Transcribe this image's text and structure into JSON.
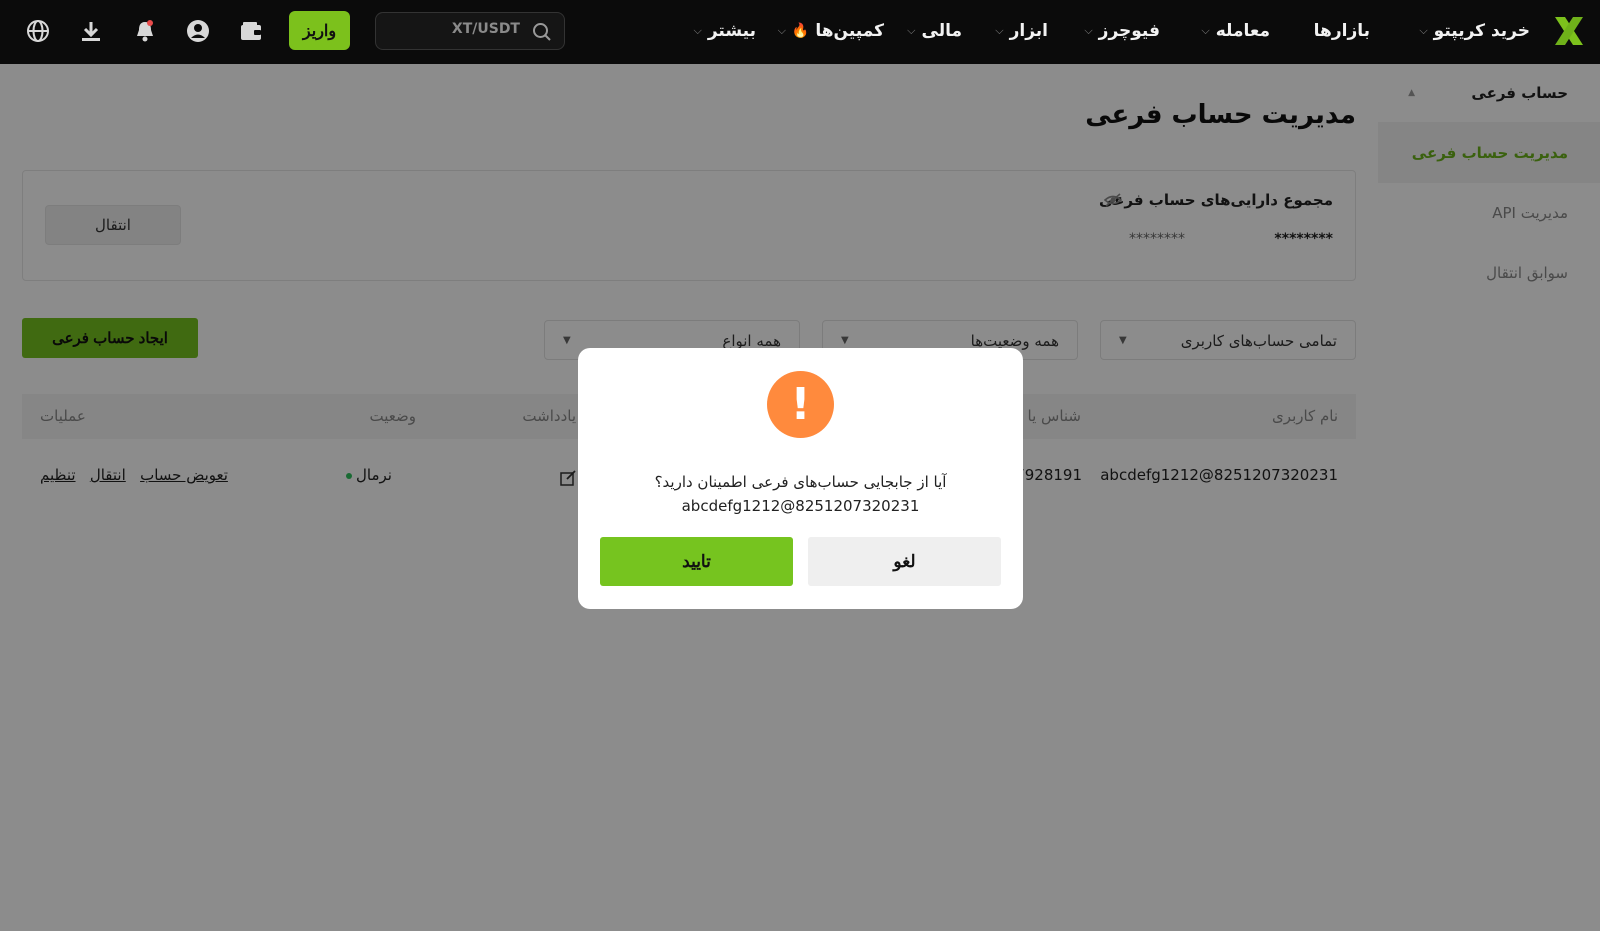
{
  "nav": {
    "items": [
      {
        "label": "خرید کریپتو",
        "has_dropdown": true
      },
      {
        "label": "بازارها",
        "has_dropdown": false
      },
      {
        "label": "معامله",
        "has_dropdown": true
      },
      {
        "label": "فیوچرز",
        "has_dropdown": true
      },
      {
        "label": "ابزار",
        "has_dropdown": true
      },
      {
        "label": "مالی",
        "has_dropdown": true
      },
      {
        "label": "کمپین‌ها",
        "has_dropdown": true,
        "hot": true
      },
      {
        "label": "بیشتر",
        "has_dropdown": true
      }
    ],
    "search_placeholder": "XT/USDT",
    "deposit_label": "واریز",
    "icons": [
      "wallet-icon",
      "user-icon",
      "bell-icon",
      "download-icon",
      "globe-icon"
    ],
    "accent_color": "#7cc11c"
  },
  "sidebar": {
    "group_title": "حساب فرعی",
    "items": [
      {
        "label": "مدیریت حساب فرعی",
        "active": true
      },
      {
        "label": "مدیریت API",
        "active": false
      },
      {
        "label": "سوابق انتقال",
        "active": false
      }
    ]
  },
  "main": {
    "title": "مدیریت حساب فرعی",
    "assets": {
      "label": "مجموع دارایی‌های حساب فرعی",
      "value_1": "********",
      "value_2": "********",
      "transfer_label": "انتقال"
    },
    "filters": [
      {
        "value": "تمامی حساب‌های کاربری"
      },
      {
        "value": "همه وضعیت‌ها"
      },
      {
        "value": "همه انواع"
      }
    ],
    "create_label": "ایجاد حساب فرعی",
    "table": {
      "columns": [
        "نام کاربری",
        "شناس یا",
        "یادداشت",
        "وضعیت",
        "عملیات"
      ],
      "rows": [
        {
          "username": "abcdefg1212@8251207320231",
          "id": "7928191",
          "status": "نرمال",
          "actions": [
            "تنظیم",
            "انتقال",
            "تعویض حساب"
          ]
        }
      ]
    }
  },
  "modal": {
    "message": "آیا از جابجایی حساب‌های فرعی اطمینان دارید؟",
    "account": "abcdefg1212@8251207320231",
    "cancel_label": "لغو",
    "confirm_label": "تایید",
    "warning_color": "#ff8a3d"
  }
}
